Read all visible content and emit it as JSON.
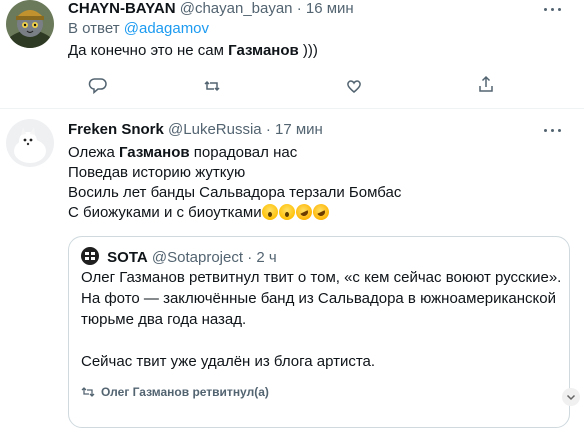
{
  "tweet1": {
    "name": "CHAYN-BAYAN",
    "handle": "@chayan_bayan",
    "dot": "·",
    "time": "16 мин",
    "reply_prefix": "В ответ",
    "reply_handle": "@adagamov",
    "text_before": "Да конечно это не сам",
    "text_bold": "Газманов",
    "text_after": ")))"
  },
  "tweet2": {
    "name": "Freken Snork",
    "handle": "@LukeRussia",
    "dot": "·",
    "time": "17 мин",
    "line1_before": "Олежа",
    "line1_bold": "Газманов",
    "line1_after": "порадовал нас",
    "line2": "Поведав историю жуткую",
    "line3": "Восиль лет банды Сальвадора терзали Бомбас",
    "line4": "С биожуками и с биоутками",
    "emojis": [
      "face-screaming-icon",
      "face-screaming-icon",
      "rolling-on-floor-laughing-icon",
      "rolling-on-floor-laughing-icon"
    ]
  },
  "quote": {
    "name": "SOTA",
    "handle": "@Sotaproject",
    "dot": "·",
    "time": "2 ч",
    "line1": "Олег Газманов ретвитнул твит о том, «с кем сейчас воюют русские».",
    "line2": "На фото — заключённые банд из Сальвадора в южноамериканской",
    "line3": "тюрьме два года назад.",
    "line4": "Сейчас твит уже удалён из блога артиста.",
    "retweet_label": "Олег Газманов ретвитнул(а)"
  },
  "colors": {
    "text": "#0f1419",
    "muted": "#536471",
    "link": "#1d9bf0",
    "border": "#cfd9de"
  }
}
